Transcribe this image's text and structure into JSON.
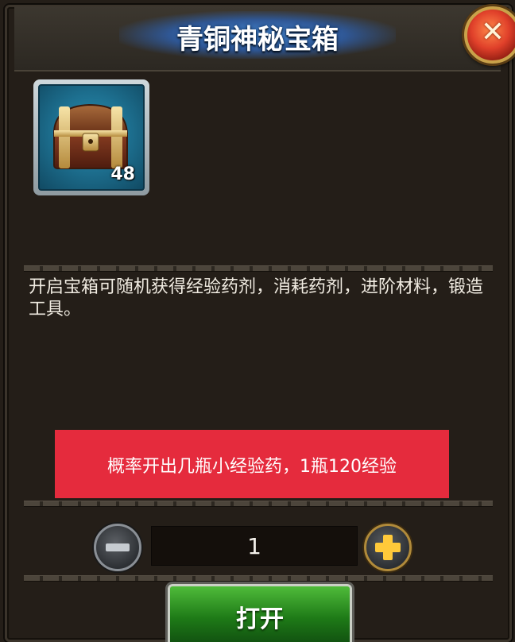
{
  "dialog": {
    "title": "青铜神秘宝箱",
    "close_icon": "close-icon"
  },
  "item": {
    "icon": "treasure-chest-icon",
    "count": "48"
  },
  "description": "开启宝箱可随机获得经验药剂，消耗药剂，进阶材料，锻造工具。",
  "note": "概率开出几瓶小经验药，1瓶120经验",
  "quantity": {
    "value": "1",
    "minus_icon": "minus-icon",
    "plus_icon": "plus-icon"
  },
  "open_button": "打开",
  "colors": {
    "note_bg": "#e52b3d",
    "button_green": "#2f9a24"
  }
}
